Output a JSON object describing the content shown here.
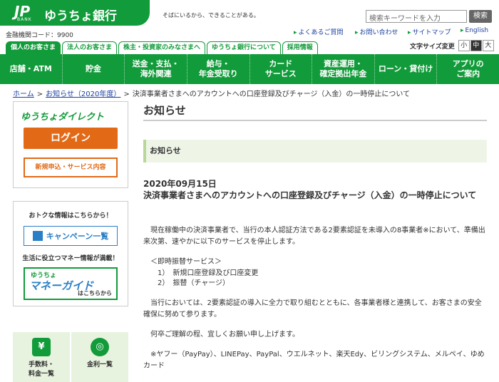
{
  "header": {
    "logo_jp": "JP",
    "logo_bank": "BANK",
    "logo_name": "ゆうちょ銀行",
    "catch": "そばにいるから、できることがある。",
    "bank_code": "金融機関コード：9900",
    "search_placeholder": "検索キーワードを入力",
    "search_button": "検索",
    "links": [
      "よくあるご質問",
      "お問い合わせ",
      "サイトマップ",
      "English"
    ]
  },
  "tabs": [
    "個人のお客さま",
    "法人のお客さま",
    "株主・投資家のみなさまへ",
    "ゆうちょ銀行について",
    "採用情報"
  ],
  "font_size": {
    "label": "文字サイズ変更",
    "options": [
      "小",
      "中",
      "大"
    ],
    "selected": "中"
  },
  "nav": [
    "店舗・ATM",
    "貯金",
    "送金・支払・\n海外関連",
    "給与・\n年金受取り",
    "カード\nサービス",
    "資産運用・\n確定拠出年金",
    "ローン・貸付け",
    "アプリの\nご案内"
  ],
  "breadcrumb": {
    "home": "ホーム",
    "parent": "お知らせ（2020年度）",
    "current": "決済事業者さまへのアカウントへの口座登録及びチャージ（入金）の一時停止について"
  },
  "sidebar": {
    "direct_title": "ゆうちょダイレクト",
    "login": "ログイン",
    "apply": "新規申込・サービス内容",
    "deals_title": "おトクな情報はこちらから！",
    "campaign": "キャンペーン一覧",
    "money_title": "生活に役立つマネー情報が満載！",
    "mg_small": "ゆうちょ",
    "mg_big": "マネーガイド",
    "mg_sub": "はこちらから",
    "bottom": [
      "手数料・\n料金一覧",
      "金利一覧"
    ]
  },
  "main": {
    "heading": "お知らせ",
    "subheading": "お知らせ",
    "date": "2020年09月15日",
    "title": "決済事業者さまへのアカウントへの口座登録及びチャージ（入金）の一時停止について",
    "p1": "　現在稼働中の決済事業者で、当行の本人認証方法である2要素認証を未導入の8事業者※において、準備出来次第、速やかに以下のサービスを停止します。",
    "p2": "　＜即時振替サービス＞",
    "p2a": "　　1）　新規口座登録及び口座変更",
    "p2b": "　　2）　振替（チャージ）",
    "p3": "　当行においては、2要素認証の導入に全力で取り組むとともに、各事業者様と連携して、お客さまの安全確保に努めて参ります。",
    "p4": "　何卒ご理解の程、宜しくお願い申し上げます。",
    "p5": "　※ヤフー（PayPay）、LINEPay、PayPal、ウエルネット、楽天Edy、ビリングシステム、メルペイ、ゆめカード"
  },
  "colors": {
    "brand_green": "#129b3a",
    "orange": "#e26a17",
    "blue": "#2a7fc7"
  }
}
